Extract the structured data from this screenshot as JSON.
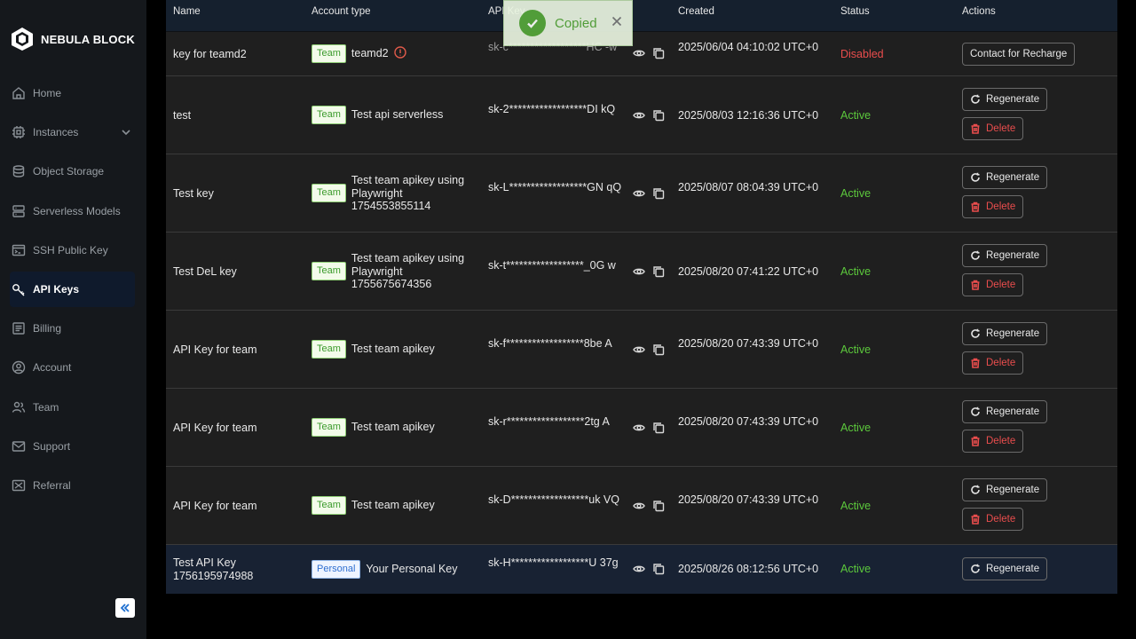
{
  "brand": {
    "name": "NEBULA BLOCK"
  },
  "sidebar": {
    "items": [
      {
        "label": "Home",
        "icon": "home-icon"
      },
      {
        "label": "Instances",
        "icon": "cpu-icon"
      },
      {
        "label": "Object Storage",
        "icon": "database-icon"
      },
      {
        "label": "Serverless Models",
        "icon": "server-icon"
      },
      {
        "label": "SSH Public Key",
        "icon": "terminal-icon"
      },
      {
        "label": "API Keys",
        "icon": "key-icon"
      },
      {
        "label": "Billing",
        "icon": "billing-icon"
      },
      {
        "label": "Account",
        "icon": "account-icon"
      },
      {
        "label": "Team",
        "icon": "team-icon"
      },
      {
        "label": "Support",
        "icon": "mail-icon"
      },
      {
        "label": "Referral",
        "icon": "referral-icon"
      }
    ],
    "active": "API Keys"
  },
  "table": {
    "headers": {
      "name": "Name",
      "account_type": "Account type",
      "api_key": "API Key",
      "created": "Created",
      "status": "Status",
      "actions": "Actions"
    },
    "rows": [
      {
        "name": "key for teamd2",
        "badge": "Team",
        "type_label": "teamd2",
        "key": "sk-c******************HC -w",
        "created": "2025/06/04 04:10:02 UTC+0",
        "status": "Disabled",
        "action1": "Contact for Recharge"
      },
      {
        "name": "test",
        "badge": "Team",
        "type_label": "Test api serverless",
        "key": "sk-2******************DI kQ",
        "created": "2025/08/03 12:16:36 UTC+0",
        "status": "Active",
        "action1": "Regenerate",
        "action2": "Delete"
      },
      {
        "name": "Test key",
        "badge": "Team",
        "type_label": "Test team apikey using Playwright 1754553855114",
        "key": "sk-L******************GN qQ",
        "created": "2025/08/07 08:04:39 UTC+0",
        "status": "Active",
        "action1": "Regenerate",
        "action2": "Delete"
      },
      {
        "name": "Test DeL key",
        "badge": "Team",
        "type_label": "Test team apikey using Playwright 1755675674356",
        "key": "sk-t******************_0G w",
        "created": "2025/08/20 07:41:22 UTC+0",
        "status": "Active",
        "action1": "Regenerate",
        "action2": "Delete"
      },
      {
        "name": "API Key for team",
        "badge": "Team",
        "type_label": "Test team apikey",
        "key": "sk-f******************8be A",
        "created": "2025/08/20 07:43:39 UTC+0",
        "status": "Active",
        "action1": "Regenerate",
        "action2": "Delete"
      },
      {
        "name": "API Key for team",
        "badge": "Team",
        "type_label": "Test team apikey",
        "key": "sk-r******************2tg A",
        "created": "2025/08/20 07:43:39 UTC+0",
        "status": "Active",
        "action1": "Regenerate",
        "action2": "Delete"
      },
      {
        "name": "API Key for team",
        "badge": "Team",
        "type_label": "Test team apikey",
        "key": "sk-D******************uk VQ",
        "created": "2025/08/20 07:43:39 UTC+0",
        "status": "Active",
        "action1": "Regenerate",
        "action2": "Delete"
      },
      {
        "name": "Test API Key 1756195974988",
        "badge": "Personal",
        "type_label": "Your Personal Key",
        "key": "sk-H******************U 37g",
        "created": "2025/08/26 08:12:56 UTC+0",
        "status": "Active",
        "action1": "Regenerate"
      }
    ]
  },
  "toast": {
    "message": "Copied"
  },
  "colors": {
    "active": "#5cc93c",
    "disabled": "#ea4d4d",
    "accent": "#1e6fd0"
  }
}
